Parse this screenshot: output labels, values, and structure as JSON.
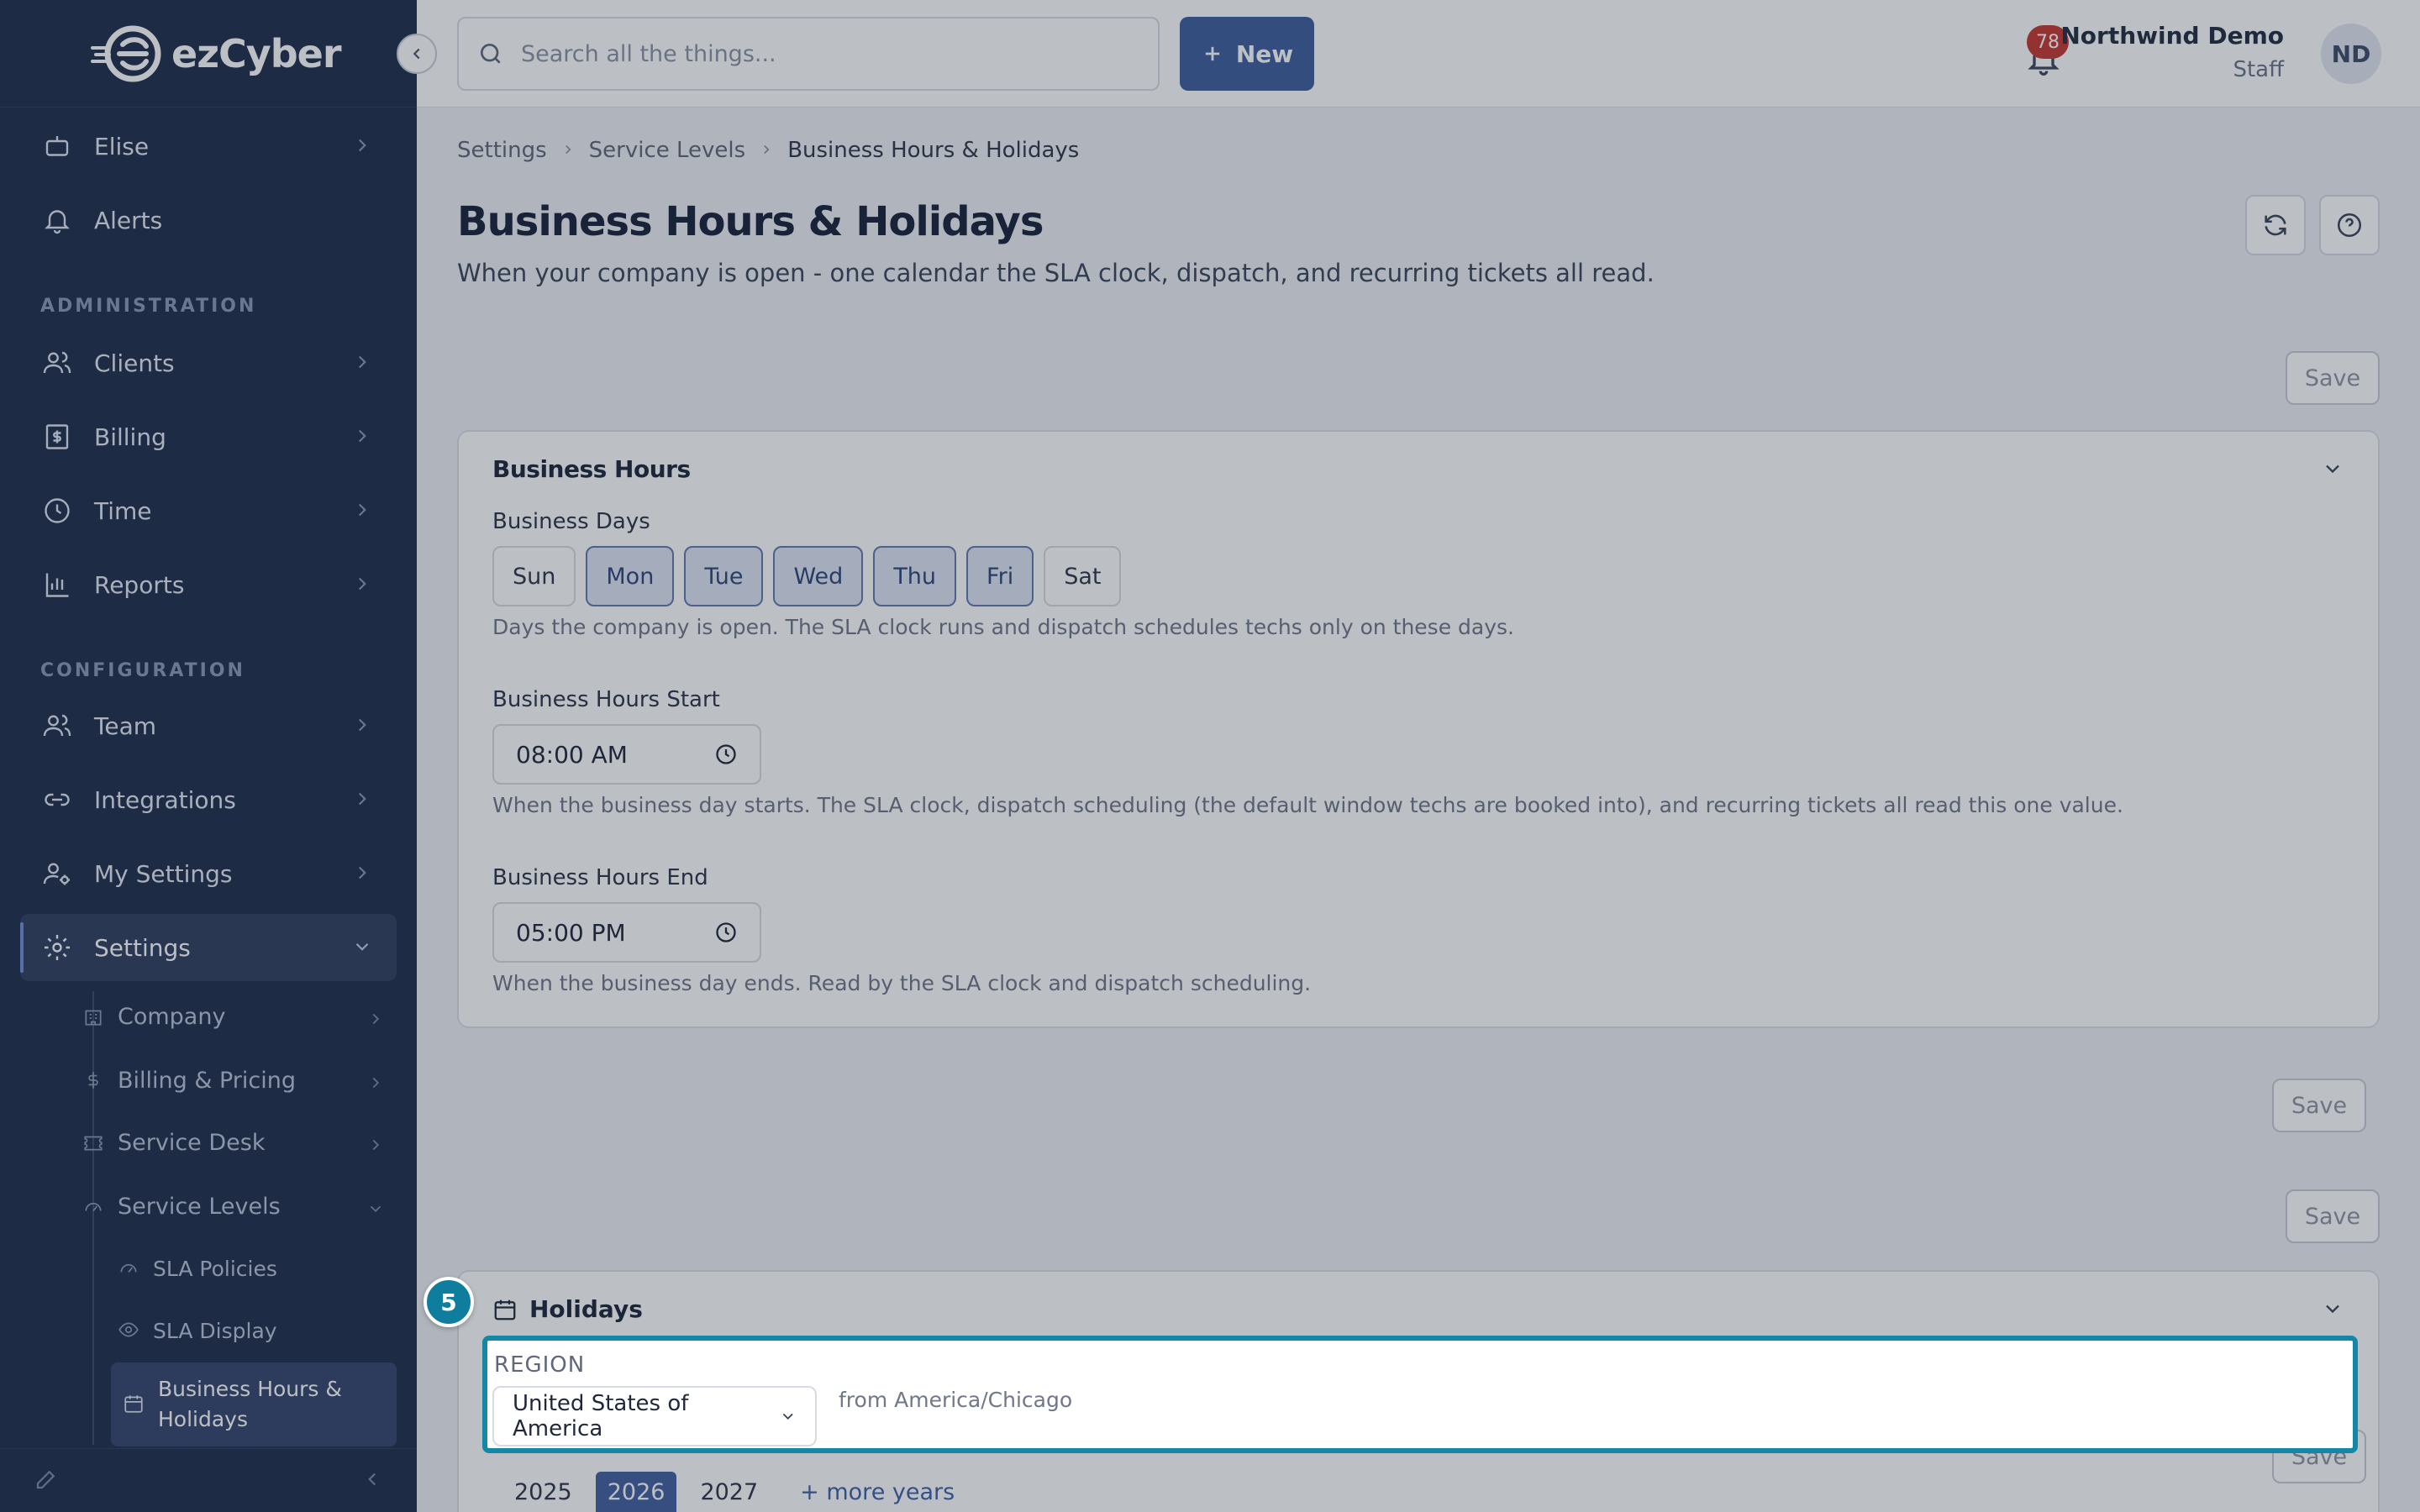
{
  "brand": {
    "logo_text": "ezCyber"
  },
  "sidebar": {
    "items": [
      {
        "label": "Elise",
        "icon": "bot-icon"
      },
      {
        "label": "Alerts",
        "icon": "bell-icon"
      },
      {
        "label": "Clients",
        "icon": "users-icon"
      },
      {
        "label": "Billing",
        "icon": "receipt-icon"
      },
      {
        "label": "Time",
        "icon": "clock-icon"
      },
      {
        "label": "Reports",
        "icon": "chart-icon"
      },
      {
        "label": "Team",
        "icon": "users-icon"
      },
      {
        "label": "Integrations",
        "icon": "link-icon"
      },
      {
        "label": "My Settings",
        "icon": "user-gear-icon"
      },
      {
        "label": "Settings",
        "icon": "gear-icon"
      }
    ],
    "section_admin": "ADMINISTRATION",
    "section_config": "CONFIGURATION",
    "settings_sub": [
      {
        "label": "Company"
      },
      {
        "label": "Billing & Pricing"
      },
      {
        "label": "Service Desk"
      },
      {
        "label": "Service Levels"
      }
    ],
    "service_levels_sub": [
      {
        "label": "SLA Policies"
      },
      {
        "label": "SLA Display"
      },
      {
        "label": "Business Hours & Holidays"
      }
    ]
  },
  "topbar": {
    "search_placeholder": "Search all the things...",
    "new_label": "New",
    "notification_count": "78",
    "user_name": "Northwind Demo",
    "user_role": "Staff",
    "avatar_initials": "ND"
  },
  "breadcrumb": [
    "Settings",
    "Service Levels",
    "Business Hours & Holidays"
  ],
  "page": {
    "title": "Business Hours & Holidays",
    "subtitle": "When your company is open - one calendar the SLA clock, dispatch, and recurring tickets all read.",
    "save_label": "Save"
  },
  "business_hours": {
    "title": "Business Hours",
    "days_label": "Business Days",
    "days": [
      {
        "label": "Sun",
        "on": false
      },
      {
        "label": "Mon",
        "on": true
      },
      {
        "label": "Tue",
        "on": true
      },
      {
        "label": "Wed",
        "on": true
      },
      {
        "label": "Thu",
        "on": true
      },
      {
        "label": "Fri",
        "on": true
      },
      {
        "label": "Sat",
        "on": false
      }
    ],
    "days_help": "Days the company is open. The SLA clock runs and dispatch schedules techs only on these days.",
    "start_label": "Business Hours Start",
    "start_value": "08:00 AM",
    "start_help": "When the business day starts. The SLA clock, dispatch scheduling (the default window techs are booked into), and recurring tickets all read this one value.",
    "end_label": "Business Hours End",
    "end_value": "05:00 PM",
    "end_help": "When the business day ends. Read by the SLA clock and dispatch scheduling."
  },
  "holidays": {
    "title": "Holidays",
    "step_number": "5",
    "region_label": "REGION",
    "region_value": "United States of America",
    "region_note": "from America/Chicago",
    "years": [
      "2025",
      "2026",
      "2027"
    ],
    "selected_year": "2026",
    "more_years": "+ more years"
  },
  "colors": {
    "sidebar_bg": "#1c2b4a",
    "accent": "#3c5c9c",
    "highlight": "#1487a6",
    "badge": "#c6362e"
  }
}
